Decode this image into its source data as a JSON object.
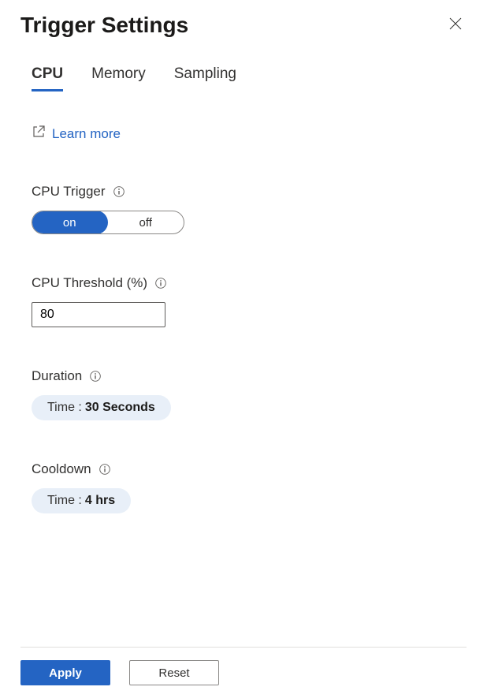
{
  "title": "Trigger Settings",
  "tabs": [
    {
      "label": "CPU",
      "active": true
    },
    {
      "label": "Memory",
      "active": false
    },
    {
      "label": "Sampling",
      "active": false
    }
  ],
  "learn_more": "Learn more",
  "fields": {
    "trigger": {
      "label": "CPU Trigger",
      "on": "on",
      "off": "off"
    },
    "threshold": {
      "label": "CPU Threshold (%)",
      "value": "80"
    },
    "duration": {
      "label": "Duration",
      "pill_label": "Time : ",
      "pill_value": "30 Seconds"
    },
    "cooldown": {
      "label": "Cooldown",
      "pill_label": "Time : ",
      "pill_value": "4 hrs"
    }
  },
  "footer": {
    "apply": "Apply",
    "reset": "Reset"
  }
}
